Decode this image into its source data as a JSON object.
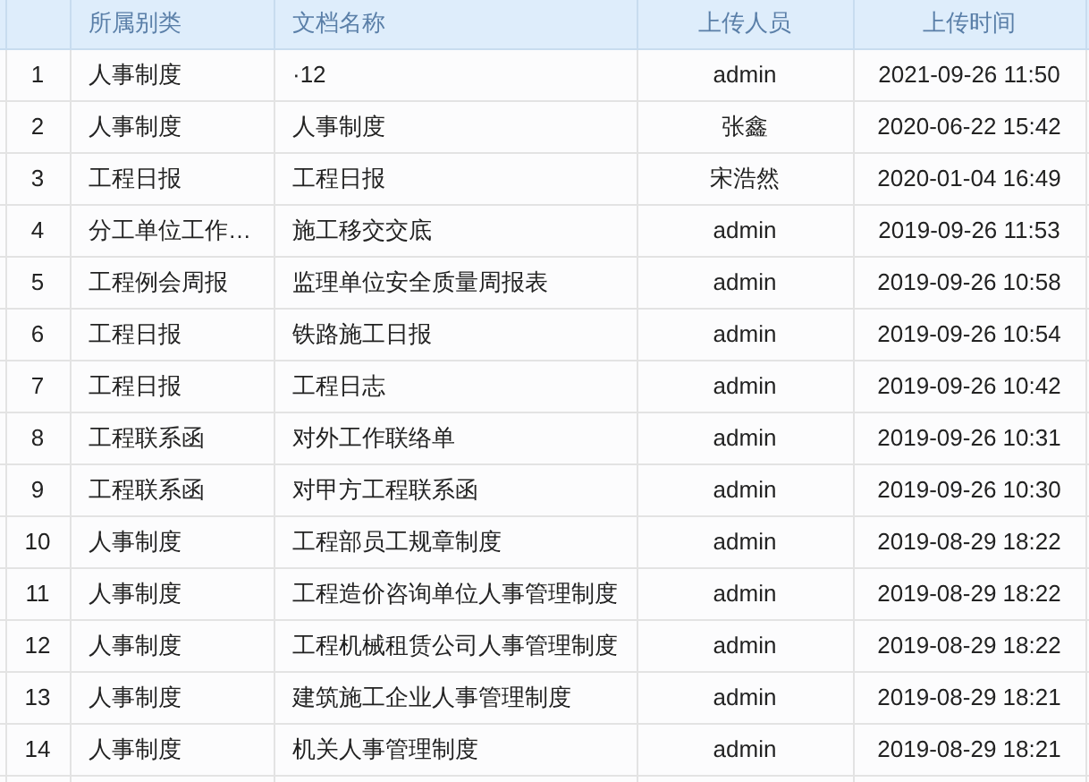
{
  "table": {
    "columns": [
      "所属别类",
      "文档名称",
      "上传人员",
      "上传时间"
    ],
    "rows": [
      {
        "index": "1",
        "category": "人事制度",
        "name": "·12",
        "uploader": "admin",
        "time": "2021-09-26 11:50"
      },
      {
        "index": "2",
        "category": "人事制度",
        "name": "人事制度",
        "uploader": "张鑫",
        "time": "2020-06-22 15:42"
      },
      {
        "index": "3",
        "category": "工程日报",
        "name": "工程日报",
        "uploader": "宋浩然",
        "time": "2020-01-04 16:49"
      },
      {
        "index": "4",
        "category": "分工单位工作…",
        "name": "施工移交交底",
        "uploader": "admin",
        "time": "2019-09-26 11:53"
      },
      {
        "index": "5",
        "category": "工程例会周报",
        "name": "监理单位安全质量周报表",
        "uploader": "admin",
        "time": "2019-09-26 10:58"
      },
      {
        "index": "6",
        "category": "工程日报",
        "name": "铁路施工日报",
        "uploader": "admin",
        "time": "2019-09-26 10:54"
      },
      {
        "index": "7",
        "category": "工程日报",
        "name": "工程日志",
        "uploader": "admin",
        "time": "2019-09-26 10:42"
      },
      {
        "index": "8",
        "category": "工程联系函",
        "name": "对外工作联络单",
        "uploader": "admin",
        "time": "2019-09-26 10:31"
      },
      {
        "index": "9",
        "category": "工程联系函",
        "name": "对甲方工程联系函",
        "uploader": "admin",
        "time": "2019-09-26 10:30"
      },
      {
        "index": "10",
        "category": "人事制度",
        "name": "工程部员工规章制度",
        "uploader": "admin",
        "time": "2019-08-29 18:22"
      },
      {
        "index": "11",
        "category": "人事制度",
        "name": "工程造价咨询单位人事管理制度",
        "uploader": "admin",
        "time": "2019-08-29 18:22"
      },
      {
        "index": "12",
        "category": "人事制度",
        "name": "工程机械租赁公司人事管理制度",
        "uploader": "admin",
        "time": "2019-08-29 18:22"
      },
      {
        "index": "13",
        "category": "人事制度",
        "name": "建筑施工企业人事管理制度",
        "uploader": "admin",
        "time": "2019-08-29 18:21"
      },
      {
        "index": "14",
        "category": "人事制度",
        "name": "机关人事管理制度",
        "uploader": "admin",
        "time": "2019-08-29 18:21"
      }
    ]
  }
}
